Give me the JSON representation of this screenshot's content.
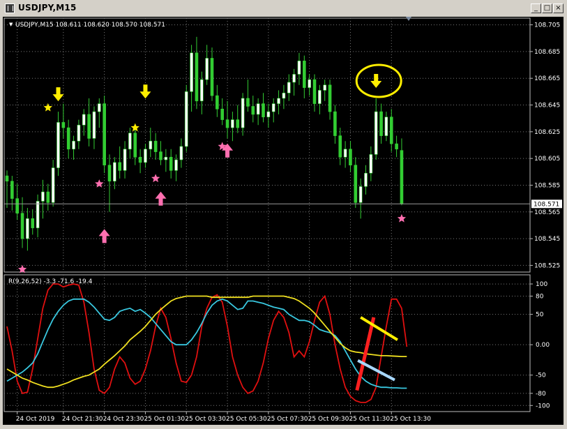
{
  "window": {
    "title": "USDJPY,M15",
    "buttons": {
      "minimize": "_",
      "restore": "□",
      "close": "×"
    }
  },
  "colors": {
    "background": "#000000",
    "grid": "#7a7a7a",
    "axis_text": "#ffffff",
    "candle_up": "#ffffff",
    "candle_down": "#32cd32",
    "red_line": "#e01010",
    "cyan_line": "#39c8e0",
    "yellow_line": "#f0e020",
    "pink_marker": "#ff6fb0",
    "yellow_marker": "#ffee00",
    "annotation_red": "#ff2020",
    "annotation_yellow": "#ffee00",
    "annotation_blue": "#a8d8ff"
  },
  "chart_data": [
    {
      "type": "candlestick",
      "header": "USDJPY,M15  108.611 108.620 108.570 108.571",
      "ylim": [
        108.52,
        108.71
      ],
      "y_ticks": [
        108.705,
        108.685,
        108.665,
        108.645,
        108.625,
        108.605,
        108.585,
        108.565,
        108.545,
        108.525
      ],
      "current_price": "108.571",
      "candles": [
        {
          "o": 108.592,
          "h": 108.596,
          "l": 108.568,
          "c": 108.588
        },
        {
          "o": 108.588,
          "h": 108.592,
          "l": 108.566,
          "c": 108.575
        },
        {
          "o": 108.575,
          "h": 108.586,
          "l": 108.559,
          "c": 108.564
        },
        {
          "o": 108.564,
          "h": 108.576,
          "l": 108.538,
          "c": 108.545
        },
        {
          "o": 108.545,
          "h": 108.568,
          "l": 108.536,
          "c": 108.56
        },
        {
          "o": 108.56,
          "h": 108.567,
          "l": 108.548,
          "c": 108.553
        },
        {
          "o": 108.553,
          "h": 108.578,
          "l": 108.546,
          "c": 108.573
        },
        {
          "o": 108.573,
          "h": 108.589,
          "l": 108.56,
          "c": 108.58
        },
        {
          "o": 108.58,
          "h": 108.586,
          "l": 108.566,
          "c": 108.572
        },
        {
          "o": 108.572,
          "h": 108.604,
          "l": 108.569,
          "c": 108.598
        },
        {
          "o": 108.598,
          "h": 108.64,
          "l": 108.592,
          "c": 108.632
        },
        {
          "o": 108.632,
          "h": 108.646,
          "l": 108.62,
          "c": 108.628
        },
        {
          "o": 108.628,
          "h": 108.634,
          "l": 108.605,
          "c": 108.612
        },
        {
          "o": 108.612,
          "h": 108.622,
          "l": 108.604,
          "c": 108.618
        },
        {
          "o": 108.618,
          "h": 108.634,
          "l": 108.612,
          "c": 108.63
        },
        {
          "o": 108.63,
          "h": 108.642,
          "l": 108.622,
          "c": 108.638
        },
        {
          "o": 108.638,
          "h": 108.65,
          "l": 108.614,
          "c": 108.62
        },
        {
          "o": 108.62,
          "h": 108.644,
          "l": 108.612,
          "c": 108.64
        },
        {
          "o": 108.64,
          "h": 108.65,
          "l": 108.628,
          "c": 108.646
        },
        {
          "o": 108.646,
          "h": 108.652,
          "l": 108.594,
          "c": 108.6
        },
        {
          "o": 108.6,
          "h": 108.608,
          "l": 108.565,
          "c": 108.588
        },
        {
          "o": 108.588,
          "h": 108.606,
          "l": 108.582,
          "c": 108.602
        },
        {
          "o": 108.602,
          "h": 108.614,
          "l": 108.59,
          "c": 108.596
        },
        {
          "o": 108.596,
          "h": 108.618,
          "l": 108.59,
          "c": 108.612
        },
        {
          "o": 108.612,
          "h": 108.628,
          "l": 108.605,
          "c": 108.624
        },
        {
          "o": 108.624,
          "h": 108.63,
          "l": 108.6,
          "c": 108.606
        },
        {
          "o": 108.606,
          "h": 108.612,
          "l": 108.594,
          "c": 108.602
        },
        {
          "o": 108.602,
          "h": 108.616,
          "l": 108.598,
          "c": 108.612
        },
        {
          "o": 108.612,
          "h": 108.628,
          "l": 108.606,
          "c": 108.618
        },
        {
          "o": 108.618,
          "h": 108.624,
          "l": 108.604,
          "c": 108.61
        },
        {
          "o": 108.61,
          "h": 108.618,
          "l": 108.6,
          "c": 108.604
        },
        {
          "o": 108.604,
          "h": 108.612,
          "l": 108.595,
          "c": 108.606
        },
        {
          "o": 108.606,
          "h": 108.612,
          "l": 108.59,
          "c": 108.596
        },
        {
          "o": 108.596,
          "h": 108.608,
          "l": 108.588,
          "c": 108.604
        },
        {
          "o": 108.604,
          "h": 108.62,
          "l": 108.598,
          "c": 108.614
        },
        {
          "o": 108.614,
          "h": 108.66,
          "l": 108.61,
          "c": 108.655
        },
        {
          "o": 108.655,
          "h": 108.69,
          "l": 108.64,
          "c": 108.684
        },
        {
          "o": 108.684,
          "h": 108.696,
          "l": 108.642,
          "c": 108.648
        },
        {
          "o": 108.648,
          "h": 108.67,
          "l": 108.638,
          "c": 108.664
        },
        {
          "o": 108.664,
          "h": 108.69,
          "l": 108.66,
          "c": 108.68
        },
        {
          "o": 108.68,
          "h": 108.688,
          "l": 108.648,
          "c": 108.652
        },
        {
          "o": 108.652,
          "h": 108.66,
          "l": 108.636,
          "c": 108.642
        },
        {
          "o": 108.642,
          "h": 108.65,
          "l": 108.63,
          "c": 108.634
        },
        {
          "o": 108.634,
          "h": 108.648,
          "l": 108.62,
          "c": 108.628
        },
        {
          "o": 108.628,
          "h": 108.64,
          "l": 108.618,
          "c": 108.634
        },
        {
          "o": 108.634,
          "h": 108.645,
          "l": 108.624,
          "c": 108.628
        },
        {
          "o": 108.628,
          "h": 108.654,
          "l": 108.622,
          "c": 108.65
        },
        {
          "o": 108.65,
          "h": 108.664,
          "l": 108.64,
          "c": 108.644
        },
        {
          "o": 108.644,
          "h": 108.652,
          "l": 108.632,
          "c": 108.638
        },
        {
          "o": 108.638,
          "h": 108.65,
          "l": 108.63,
          "c": 108.646
        },
        {
          "o": 108.646,
          "h": 108.654,
          "l": 108.632,
          "c": 108.636
        },
        {
          "o": 108.636,
          "h": 108.646,
          "l": 108.628,
          "c": 108.64
        },
        {
          "o": 108.64,
          "h": 108.65,
          "l": 108.632,
          "c": 108.646
        },
        {
          "o": 108.646,
          "h": 108.656,
          "l": 108.638,
          "c": 108.65
        },
        {
          "o": 108.65,
          "h": 108.66,
          "l": 108.642,
          "c": 108.654
        },
        {
          "o": 108.654,
          "h": 108.668,
          "l": 108.648,
          "c": 108.662
        },
        {
          "o": 108.662,
          "h": 108.672,
          "l": 108.652,
          "c": 108.668
        },
        {
          "o": 108.668,
          "h": 108.684,
          "l": 108.66,
          "c": 108.678
        },
        {
          "o": 108.678,
          "h": 108.682,
          "l": 108.65,
          "c": 108.658
        },
        {
          "o": 108.658,
          "h": 108.668,
          "l": 108.652,
          "c": 108.664
        },
        {
          "o": 108.664,
          "h": 108.668,
          "l": 108.64,
          "c": 108.646
        },
        {
          "o": 108.646,
          "h": 108.66,
          "l": 108.638,
          "c": 108.656
        },
        {
          "o": 108.656,
          "h": 108.664,
          "l": 108.648,
          "c": 108.66
        },
        {
          "o": 108.66,
          "h": 108.664,
          "l": 108.634,
          "c": 108.64
        },
        {
          "o": 108.64,
          "h": 108.645,
          "l": 108.616,
          "c": 108.622
        },
        {
          "o": 108.622,
          "h": 108.628,
          "l": 108.6,
          "c": 108.606
        },
        {
          "o": 108.606,
          "h": 108.618,
          "l": 108.598,
          "c": 108.612
        },
        {
          "o": 108.612,
          "h": 108.618,
          "l": 108.595,
          "c": 108.6
        },
        {
          "o": 108.6,
          "h": 108.606,
          "l": 108.568,
          "c": 108.572
        },
        {
          "o": 108.572,
          "h": 108.59,
          "l": 108.56,
          "c": 108.584
        },
        {
          "o": 108.584,
          "h": 108.6,
          "l": 108.578,
          "c": 108.594
        },
        {
          "o": 108.594,
          "h": 108.614,
          "l": 108.588,
          "c": 108.608
        },
        {
          "o": 108.608,
          "h": 108.65,
          "l": 108.604,
          "c": 108.64
        },
        {
          "o": 108.64,
          "h": 108.646,
          "l": 108.616,
          "c": 108.622
        },
        {
          "o": 108.622,
          "h": 108.64,
          "l": 108.618,
          "c": 108.636
        },
        {
          "o": 108.636,
          "h": 108.642,
          "l": 108.61,
          "c": 108.616
        },
        {
          "o": 108.616,
          "h": 108.622,
          "l": 108.606,
          "c": 108.612
        },
        {
          "o": 108.611,
          "h": 108.62,
          "l": 108.57,
          "c": 108.571
        }
      ],
      "stars": [
        {
          "i": 8,
          "price": 108.643,
          "color": "yellow"
        },
        {
          "i": 18,
          "price": 108.586,
          "color": "pink"
        },
        {
          "i": 25,
          "price": 108.628,
          "color": "yellow"
        },
        {
          "i": 29,
          "price": 108.59,
          "color": "pink"
        },
        {
          "i": 42,
          "price": 108.614,
          "color": "pink"
        },
        {
          "i": 3,
          "price": 108.522,
          "color": "pink"
        },
        {
          "i": 77,
          "price": 108.56,
          "color": "pink"
        }
      ],
      "arrows": [
        {
          "i": 10,
          "price": 108.652,
          "dir": "down",
          "color": "yellow"
        },
        {
          "i": 27,
          "price": 108.654,
          "dir": "down",
          "color": "yellow"
        },
        {
          "i": 72,
          "price": 108.662,
          "dir": "down",
          "color": "yellow"
        },
        {
          "i": 19,
          "price": 108.548,
          "dir": "up",
          "color": "pink"
        },
        {
          "i": 30,
          "price": 108.576,
          "dir": "up",
          "color": "pink"
        },
        {
          "i": 43,
          "price": 108.612,
          "dir": "up",
          "color": "pink"
        }
      ]
    },
    {
      "type": "line",
      "header": "R(9,26,52) -3.3 -71.6 -19.4",
      "ylim": [
        -110,
        115
      ],
      "y_ticks": [
        {
          "v": 100,
          "label": "100"
        },
        {
          "v": 80,
          "label": "80"
        },
        {
          "v": 50,
          "label": "50"
        },
        {
          "v": 0,
          "label": "0.00"
        },
        {
          "v": -50,
          "label": "-50"
        },
        {
          "v": -80,
          "label": "-80"
        },
        {
          "v": -100,
          "label": "-100"
        }
      ],
      "series": [
        {
          "color": "red",
          "values": [
            30,
            -10,
            -60,
            -80,
            -78,
            -40,
            10,
            60,
            90,
            100,
            100,
            95,
            98,
            100,
            98,
            70,
            20,
            -40,
            -75,
            -80,
            -70,
            -40,
            -20,
            -30,
            -55,
            -65,
            -60,
            -40,
            -10,
            30,
            60,
            45,
            10,
            -30,
            -60,
            -62,
            -50,
            -20,
            30,
            60,
            78,
            82,
            70,
            30,
            -20,
            -50,
            -70,
            -80,
            -76,
            -60,
            -30,
            10,
            40,
            55,
            45,
            20,
            -20,
            -10,
            -20,
            5,
            40,
            70,
            80,
            50,
            0,
            -40,
            -70,
            -85,
            -92,
            -95,
            -95,
            -90,
            -70,
            -20,
            30,
            75,
            75,
            60,
            -3.3
          ]
        },
        {
          "color": "cyan",
          "values": [
            -60,
            -55,
            -50,
            -45,
            -38,
            -30,
            -15,
            5,
            25,
            42,
            55,
            65,
            72,
            75,
            75,
            75,
            70,
            62,
            52,
            42,
            40,
            45,
            55,
            58,
            60,
            55,
            58,
            52,
            45,
            35,
            25,
            15,
            5,
            0,
            0,
            0,
            8,
            20,
            35,
            52,
            65,
            72,
            75,
            72,
            65,
            58,
            60,
            72,
            72,
            70,
            68,
            65,
            62,
            60,
            58,
            50,
            45,
            40,
            40,
            38,
            32,
            25,
            22,
            20,
            15,
            5,
            -10,
            -25,
            -40,
            -52,
            -60,
            -65,
            -68,
            -70,
            -70,
            -71,
            -71,
            -71.6,
            -71.6
          ]
        },
        {
          "color": "yellow",
          "values": [
            -40,
            -45,
            -50,
            -55,
            -58,
            -62,
            -65,
            -68,
            -70,
            -70,
            -68,
            -65,
            -62,
            -58,
            -55,
            -52,
            -50,
            -45,
            -40,
            -32,
            -25,
            -18,
            -10,
            -2,
            8,
            15,
            22,
            30,
            40,
            50,
            58,
            65,
            72,
            76,
            78,
            80,
            80,
            80,
            80,
            80,
            78,
            78,
            78,
            78,
            78,
            78,
            78,
            78,
            80,
            80,
            80,
            80,
            80,
            80,
            80,
            78,
            76,
            72,
            66,
            60,
            52,
            42,
            32,
            22,
            12,
            2,
            -5,
            -10,
            -12,
            -13,
            -15,
            -16,
            -17,
            -18,
            -18,
            -18.5,
            -19,
            -19.4,
            -19.4
          ]
        }
      ]
    }
  ],
  "x_axis": {
    "labels": [
      {
        "i": 2,
        "text": "24 Oct 2019"
      },
      {
        "i": 11,
        "text": "24 Oct 21:30"
      },
      {
        "i": 19,
        "text": "24 Oct 23:30"
      },
      {
        "i": 27,
        "text": "25 Oct 01:30"
      },
      {
        "i": 35,
        "text": "25 Oct 03:30"
      },
      {
        "i": 43,
        "text": "25 Oct 05:30"
      },
      {
        "i": 51,
        "text": "25 Oct 07:30"
      },
      {
        "i": 59,
        "text": "25 Oct 09:30"
      },
      {
        "i": 67,
        "text": "25 Oct 11:30"
      },
      {
        "i": 75,
        "text": "25 Oct 13:30"
      }
    ]
  }
}
